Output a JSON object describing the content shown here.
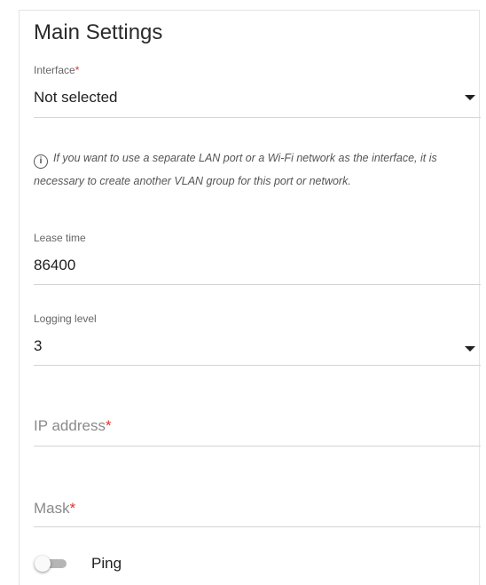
{
  "section": {
    "title": "Main Settings"
  },
  "interface": {
    "label": "Interface",
    "required_mark": "*",
    "value": "Not selected"
  },
  "info": {
    "icon": "info-icon",
    "icon_glyph": "i",
    "text": "If you want to use a separate LAN port or a Wi-Fi network as the interface, it is necessary to create another VLAN group for this port or network."
  },
  "lease_time": {
    "label": "Lease time",
    "value": "86400"
  },
  "logging_level": {
    "label": "Logging level",
    "value": "3"
  },
  "ip_address": {
    "placeholder": "IP address",
    "required_mark": "*"
  },
  "mask": {
    "placeholder": "Mask",
    "required_mark": "*"
  },
  "ping": {
    "label": "Ping",
    "enabled": false
  },
  "colors": {
    "required": "#e0342c",
    "text": "#1f1f1f",
    "muted": "#666666",
    "divider": "#d4d4d4"
  }
}
